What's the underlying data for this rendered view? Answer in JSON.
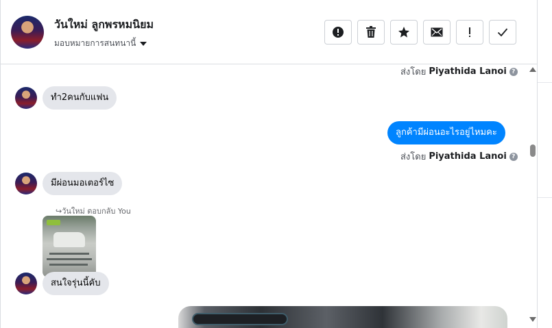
{
  "header": {
    "contact_name": "วันใหม่ ลูกพรหมนิยม",
    "assign_label": "มอบหมายการสนทนานี้",
    "tools": [
      {
        "name": "report-button",
        "icon": "alert-circle-icon"
      },
      {
        "name": "delete-button",
        "icon": "trash-icon"
      },
      {
        "name": "star-button",
        "icon": "star-icon"
      },
      {
        "name": "mail-button",
        "icon": "envelope-icon"
      },
      {
        "name": "mark-important-button",
        "icon": "exclamation-icon"
      },
      {
        "name": "done-button",
        "icon": "checkmark-icon"
      }
    ]
  },
  "thread": {
    "sent_by_prefix": "ส่งโดย",
    "agent_name": "Piyathida Lanoi",
    "messages": [
      {
        "direction": "in",
        "text": "ทำ2คนกับแฟน"
      },
      {
        "direction": "out",
        "text": "ลูกค้ามีผ่อนอะไรอยู่ไหมคะ"
      },
      {
        "direction": "in",
        "text": "มีผ่อนมอเตอร์ไซ"
      },
      {
        "direction": "in",
        "text": "สนใจรุ่นนี้คับ"
      }
    ],
    "reply_meta": "วันใหม่ ตอบกลับ You"
  },
  "colors": {
    "accent": "#0084ff",
    "incoming_bubble": "#e4e6eb"
  }
}
